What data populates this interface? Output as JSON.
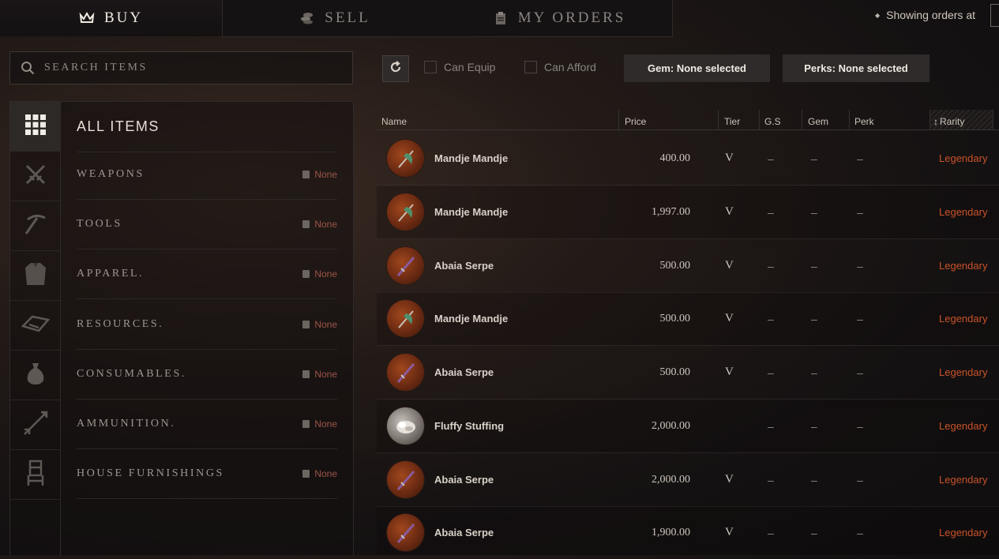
{
  "tabs": [
    {
      "label": "BUY",
      "icon": "crown-icon"
    },
    {
      "label": "SELL",
      "icon": "coins-icon"
    },
    {
      "label": "MY ORDERS",
      "icon": "clipboard-icon"
    }
  ],
  "showing_label": "Showing orders at",
  "search": {
    "placeholder": "SEARCH ITEMS"
  },
  "categories": [
    {
      "label": "ALL ITEMS",
      "icon": "grid-icon",
      "badge": ""
    },
    {
      "label": "WEAPONS",
      "icon": "crossed-swords-icon",
      "badge": "None"
    },
    {
      "label": "TOOLS",
      "icon": "pickaxe-icon",
      "badge": "None"
    },
    {
      "label": "APPAREL.",
      "icon": "shirt-icon",
      "badge": "None"
    },
    {
      "label": "RESOURCES.",
      "icon": "ingot-icon",
      "badge": "None"
    },
    {
      "label": "CONSUMABLES.",
      "icon": "pouch-icon",
      "badge": "None"
    },
    {
      "label": "AMMUNITION.",
      "icon": "arrow-icon",
      "badge": "None"
    },
    {
      "label": "HOUSE FURNISHINGS",
      "icon": "chair-icon",
      "badge": "None"
    }
  ],
  "filters": {
    "refresh_icon": "refresh-icon",
    "can_equip": "Can Equip",
    "can_afford": "Can Afford",
    "gem_button": "Gem: None selected",
    "perks_button": "Perks: None selected"
  },
  "table": {
    "columns": [
      "Name",
      "Price",
      "Tier",
      "G.S",
      "Gem",
      "Perk",
      "Rarity"
    ],
    "sort_indicator": "↕",
    "rows": [
      {
        "name": "Mandje Mandje",
        "price": "400.00",
        "tier": "V",
        "gs": "–",
        "gem": "–",
        "perk": "–",
        "rarity": "Legendary",
        "icon": "axe-weapon-icon"
      },
      {
        "name": "Mandje Mandje",
        "price": "1,997.00",
        "tier": "V",
        "gs": "–",
        "gem": "–",
        "perk": "–",
        "rarity": "Legendary",
        "icon": "axe-weapon-icon"
      },
      {
        "name": "Abaia Serpe",
        "price": "500.00",
        "tier": "V",
        "gs": "–",
        "gem": "–",
        "perk": "–",
        "rarity": "Legendary",
        "icon": "sword-weapon-icon"
      },
      {
        "name": "Mandje Mandje",
        "price": "500.00",
        "tier": "V",
        "gs": "–",
        "gem": "–",
        "perk": "–",
        "rarity": "Legendary",
        "icon": "axe-weapon-icon"
      },
      {
        "name": "Abaia Serpe",
        "price": "500.00",
        "tier": "V",
        "gs": "–",
        "gem": "–",
        "perk": "–",
        "rarity": "Legendary",
        "icon": "sword-weapon-icon"
      },
      {
        "name": "Fluffy Stuffing",
        "price": "2,000.00",
        "tier": "",
        "gs": "–",
        "gem": "–",
        "perk": "–",
        "rarity": "Legendary",
        "icon": "stuffing-icon"
      },
      {
        "name": "Abaia Serpe",
        "price": "2,000.00",
        "tier": "V",
        "gs": "–",
        "gem": "–",
        "perk": "–",
        "rarity": "Legendary",
        "icon": "sword-weapon-icon"
      },
      {
        "name": "Abaia Serpe",
        "price": "1,900.00",
        "tier": "V",
        "gs": "–",
        "gem": "–",
        "perk": "–",
        "rarity": "Legendary",
        "icon": "sword-weapon-icon"
      }
    ]
  },
  "colors": {
    "rarity_legendary": "#c9532a",
    "badge": "#9b5547"
  }
}
